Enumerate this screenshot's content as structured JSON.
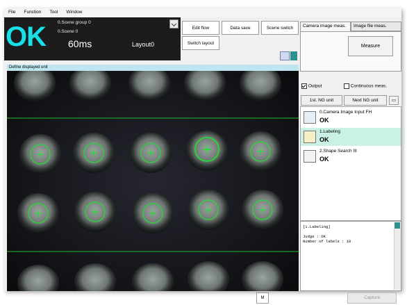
{
  "menu": [
    "File",
    "Function",
    "Tool",
    "Window"
  ],
  "status": {
    "judgement": "OK",
    "scene_group": "0.Scene group 0",
    "scene": "0.Scene 0",
    "time": "60ms",
    "layout": "Layout0"
  },
  "toolbar": {
    "edit_flow": "Edit flow",
    "data_save": "Data save",
    "scene_switch": "Scene switch",
    "switch_layout": "Switch layout"
  },
  "tabs": [
    "Camera image meas.",
    "Image file meas."
  ],
  "measure_label": "Measure",
  "options": {
    "output": "Output",
    "continuous": "Continuous meas."
  },
  "ng_nav": {
    "first": "1st. NG unit",
    "next": "Next NG unit"
  },
  "units": [
    {
      "name": "0.Camera Image Input FH",
      "result": "OK",
      "icon": "camera-icon"
    },
    {
      "name": "1.Labeling",
      "result": "OK",
      "icon": "labeling-icon"
    },
    {
      "name": "2.Shape Search III",
      "result": "OK",
      "icon": "shape-search-icon"
    }
  ],
  "viewer_title": "Define displayed unit",
  "result_text": {
    "heading": "[1.Labeling]",
    "judge": "Judge : OK",
    "labels": "Number of labels : 10"
  },
  "bottom": {
    "m_button": "M",
    "capture": "Capture"
  },
  "colors": {
    "ok_cyan": "#19e0e8",
    "detect_green": "#22dd33",
    "selected_unit": "#c9f2e4"
  }
}
